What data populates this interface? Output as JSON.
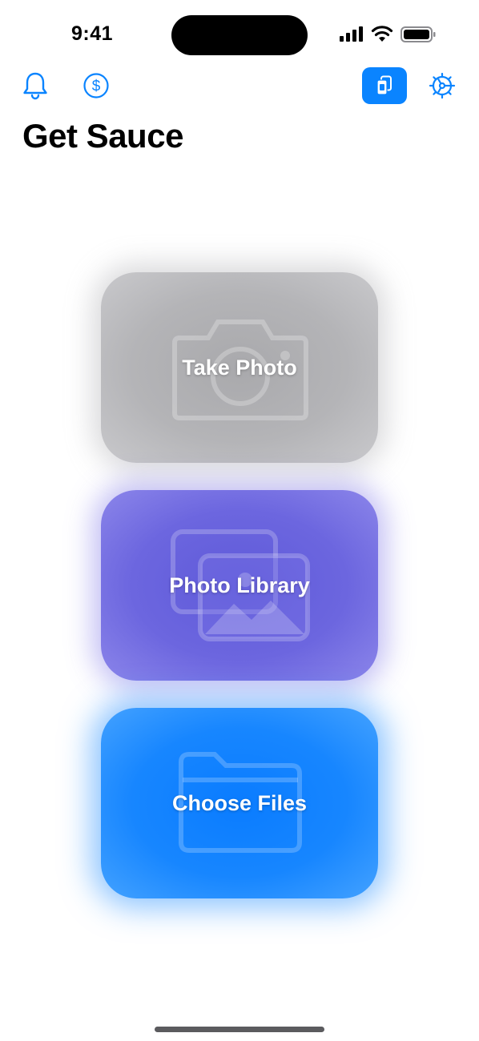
{
  "status_bar": {
    "time": "9:41"
  },
  "header": {
    "title": "Get Sauce"
  },
  "toolbar": {
    "left_icons": [
      "bell-icon",
      "dollar-circle-icon"
    ],
    "right_icons": [
      "cards-icon",
      "gear-icon"
    ]
  },
  "actions": [
    {
      "label": "Take Photo",
      "icon": "camera-icon",
      "color": "#b0b0b3"
    },
    {
      "label": "Photo Library",
      "icon": "photos-icon",
      "color": "#6a64de"
    },
    {
      "label": "Choose Files",
      "icon": "folder-icon",
      "color": "#1585ff"
    }
  ],
  "colors": {
    "accent": "#0a84ff"
  }
}
